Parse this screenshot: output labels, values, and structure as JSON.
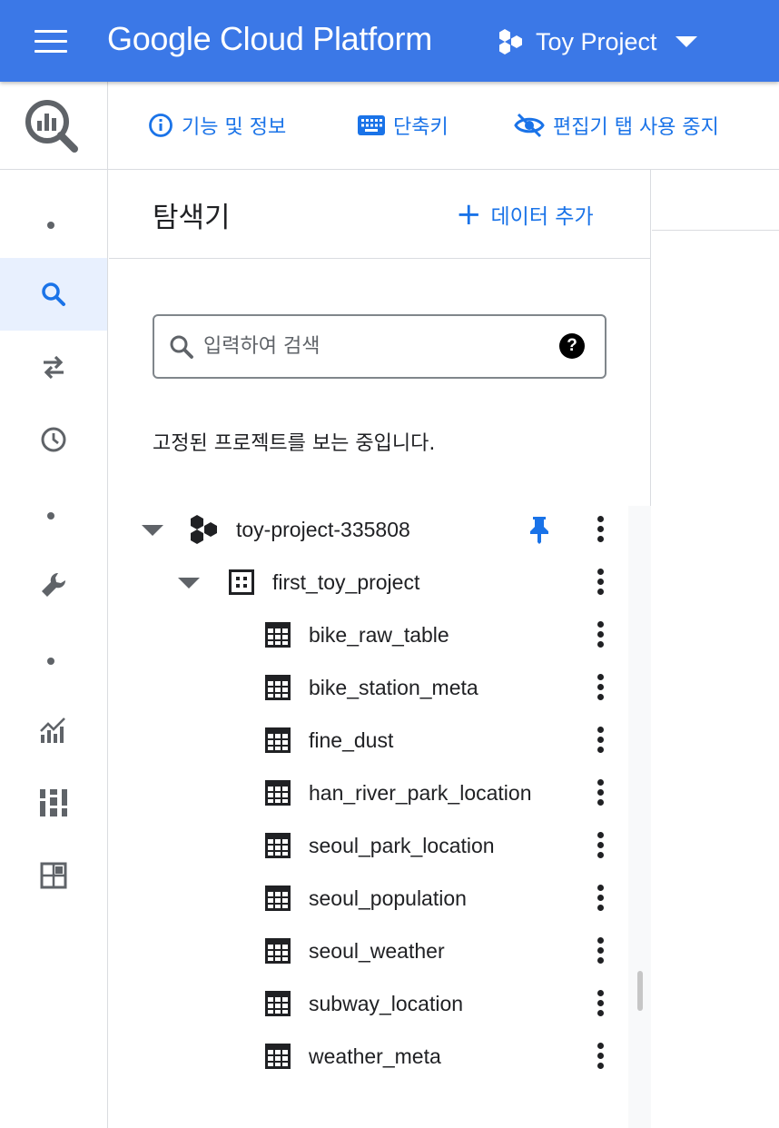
{
  "topbar": {
    "brand": "Google Cloud Platform",
    "project_name": "Toy Project"
  },
  "toolbar": {
    "features_info": "기능 및 정보",
    "shortcuts": "단축키",
    "disable_editor_tabs": "편집기 탭 사용 중지"
  },
  "leftnav": {
    "items": [
      "search-icon",
      "transfer-icon",
      "history-icon",
      "wrench-icon",
      "analytics-icon",
      "dashboard-icon",
      "grid-icon"
    ],
    "active": "search-icon"
  },
  "explorer": {
    "title": "탐색기",
    "add_data": "데이터 추가",
    "search_placeholder": "입력하여 검색",
    "pinned_message": "고정된 프로젝트를 보는 중입니다.",
    "project": "toy-project-335808",
    "dataset": "first_toy_project",
    "tables": [
      "bike_raw_table",
      "bike_station_meta",
      "fine_dust",
      "han_river_park_location",
      "seoul_park_location",
      "seoul_population",
      "seoul_weather",
      "subway_location",
      "weather_meta"
    ]
  },
  "colors": {
    "topbar": "#3b78e7",
    "accent": "#1a73e8",
    "active_nav_bg": "#e8f0fe"
  }
}
